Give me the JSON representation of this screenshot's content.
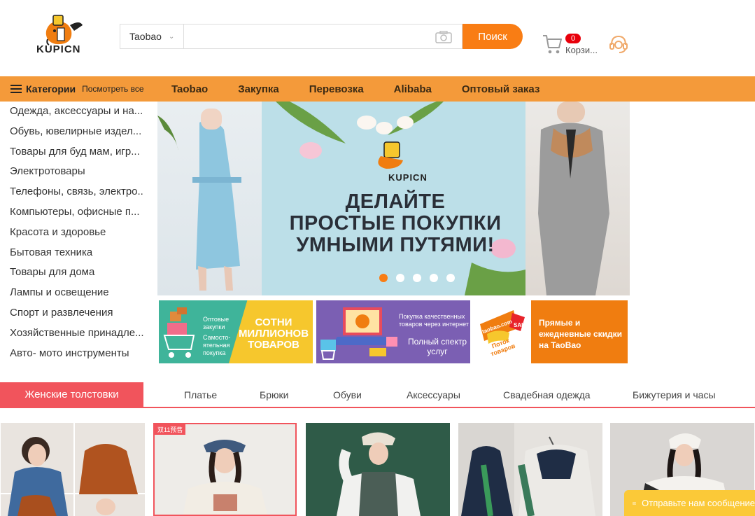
{
  "brand": {
    "name": "KUPICN",
    "accent": "#f97d14"
  },
  "search": {
    "scope": "Taobao",
    "placeholder": "",
    "button": "Поиск"
  },
  "cart": {
    "count": "0",
    "label": "Корзи..."
  },
  "nav": {
    "categories_title": "Категории",
    "view_all": "Посмотреть все",
    "items": [
      "Taobao",
      "Закупка",
      "Перевозка",
      "Alibaba",
      "Оптовый заказ"
    ]
  },
  "categories": [
    "Одежда, аксессуары и на...",
    "Обувь, ювелирные издел...",
    "Товары для буд мам, игр...",
    "Электротовары",
    "Телефоны, связь, электро...",
    "Компьютеры, офисные п...",
    "Красота и здоровье",
    "Бытовая техника",
    "Товары для дома",
    "Лампы и освещение",
    "Спорт и развлечения",
    "Хозяйственные принадле...",
    "Авто- мото инструменты"
  ],
  "banner": {
    "logo_text": "KUPICN",
    "headline": [
      "ДЕЛАЙТЕ",
      "ПРОСТЫЕ ПОКУПКИ",
      "УМНЫМИ ПУТЯМИ!"
    ],
    "slide_count": 5,
    "active_slide": 1
  },
  "promos": [
    {
      "small": [
        "Оптовые",
        "закупки",
        "",
        "Самосто-",
        "ятельная",
        "покупка"
      ],
      "big": "СОТНИ МИЛЛИОНОВ ТОВАРОВ"
    },
    {
      "small": [
        "Покупка качественных",
        "товаров через интернет"
      ],
      "big": "Полный спектр услуг"
    },
    {
      "small": [
        "taobao.com",
        "SALE"
      ],
      "big": "Поток товаров"
    },
    {
      "title": "Прямые и ежедневные скидки на TaoBao"
    }
  ],
  "tabs": {
    "active": "Женские толстовки",
    "items": [
      "Платье",
      "Брюки",
      "Обуви",
      "Аксессуары",
      "Свадебная одежда",
      "Бижутерия и часы"
    ]
  },
  "products": [
    {
      "tag": ""
    },
    {
      "tag": "双11预售"
    },
    {
      "tag": ""
    },
    {
      "tag": ""
    },
    {
      "tag": ""
    }
  ],
  "chat": {
    "label": "Отправьте нам сообщение"
  },
  "colors": {
    "nav_bg": "#f49a3a",
    "tab_accent": "#f1545c",
    "chat_bg": "#fbc938"
  }
}
